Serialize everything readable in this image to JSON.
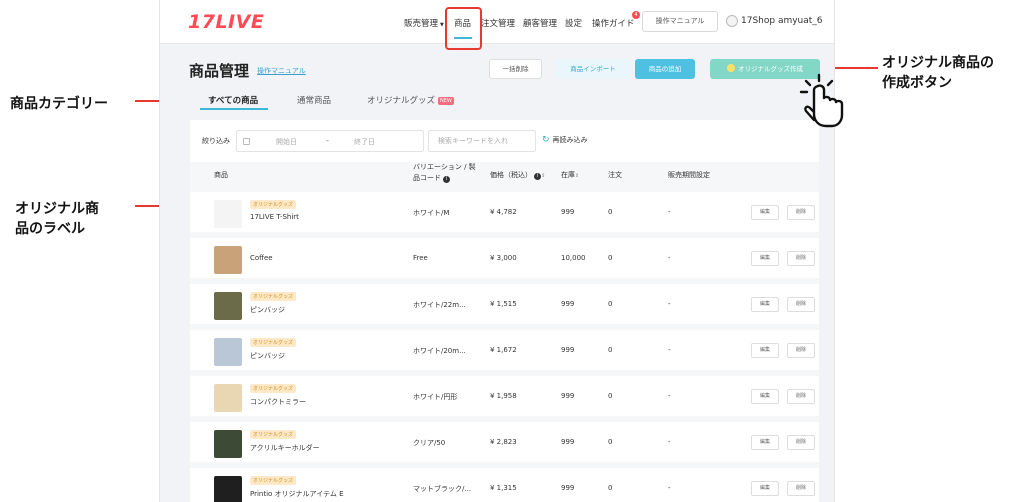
{
  "header": {
    "logo": "17LIVE",
    "nav": [
      {
        "label": "販売管理",
        "has_dropdown": true
      },
      {
        "label": "商品",
        "active": true
      },
      {
        "label": "注文管理"
      },
      {
        "label": "顧客管理"
      },
      {
        "label": "設定"
      },
      {
        "label": "操作ガイド",
        "badge": "4"
      }
    ],
    "manual_button": "操作マニュアル",
    "username": "17Shop amyuat_6"
  },
  "page": {
    "title": "商品管理",
    "manual_link": "操作マニュアル",
    "buttons": {
      "bulk_delete": "一括削除",
      "import": "商品インポート",
      "add": "商品の追加",
      "original_create": "オリジナルグッズ作成"
    }
  },
  "tabs": [
    {
      "label": "すべての商品",
      "active": true
    },
    {
      "label": "通常商品"
    },
    {
      "label": "オリジナルグッズ",
      "badge": "NEW"
    }
  ],
  "filter": {
    "label": "絞り込み",
    "start_placeholder": "開始日",
    "separator": "-",
    "end_placeholder": "終了日",
    "search_placeholder": "検索キーワードを入れ",
    "reload": "再読み込み"
  },
  "table": {
    "headers": {
      "product": "商品",
      "variation_line1": "バリエーション / 製",
      "variation_line2": "品コード",
      "price": "価格（税込）",
      "stock": "在庫",
      "orders": "注文",
      "sales_period": "販売期間設定"
    },
    "edit_label": "編集",
    "delete_label": "削除",
    "rows": [
      {
        "label": "オリジナルグッズ",
        "name": "17LIVE T-Shirt",
        "variation": "ホワイト/M",
        "price": "¥ 4,782",
        "stock": "999",
        "orders": "0",
        "period": "-",
        "thumb_color": "#f4f4f4"
      },
      {
        "label": "",
        "name": "Coffee",
        "variation": "Free",
        "price": "¥ 3,000",
        "stock": "10,000",
        "orders": "0",
        "period": "-",
        "thumb_color": "#c9a27a"
      },
      {
        "label": "オリジナルグッズ",
        "name": "ピンバッジ",
        "variation": "ホワイト/22m...",
        "price": "¥ 1,515",
        "stock": "999",
        "orders": "0",
        "period": "-",
        "thumb_color": "#6b6b4a"
      },
      {
        "label": "オリジナルグッズ",
        "name": "ピンバッジ",
        "variation": "ホワイト/20m...",
        "price": "¥ 1,672",
        "stock": "999",
        "orders": "0",
        "period": "-",
        "thumb_color": "#b9c7d6"
      },
      {
        "label": "オリジナルグッズ",
        "name": "コンパクトミラー",
        "variation": "ホワイト/円形",
        "price": "¥ 1,958",
        "stock": "999",
        "orders": "0",
        "period": "-",
        "thumb_color": "#e9d7b4"
      },
      {
        "label": "オリジナルグッズ",
        "name": "アクリルキーホルダー",
        "variation": "クリア/50",
        "price": "¥ 2,823",
        "stock": "999",
        "orders": "0",
        "period": "-",
        "thumb_color": "#3d4a36"
      },
      {
        "label": "オリジナルグッズ",
        "name": "Printio オリジナルアイテム E",
        "variation": "マットブラック/...",
        "price": "¥ 1,315",
        "stock": "999",
        "orders": "0",
        "period": "-",
        "thumb_color": "#1f1f1f"
      }
    ]
  },
  "annotations": {
    "category": "商品カテゴリー",
    "label_line1": "オリジナル商",
    "label_line2": "品のラベル",
    "create_line1": "オリジナル商品の",
    "create_line2": "作成ボタン"
  },
  "colors": {
    "brand": "#ff4b55",
    "accent": "#3db8d8",
    "annotation": "#e8382f",
    "original_button": "#83d7c6",
    "label_bg": "#fde9c8"
  }
}
